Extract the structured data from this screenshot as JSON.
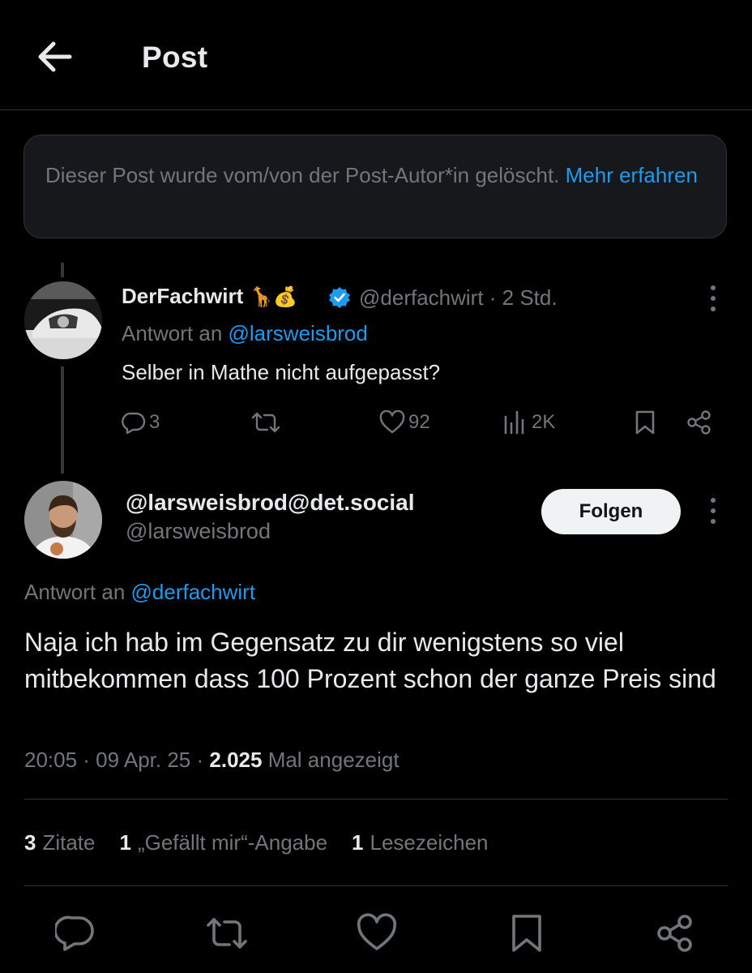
{
  "header": {
    "title": "Post"
  },
  "notice": {
    "text": "Dieser Post wurde vom/von der Post-Autor*in gelöscht. ",
    "link": "Mehr erfahren"
  },
  "reply": {
    "author_name": "DerFachwirt",
    "emojis": "🦒💰",
    "handle_time": "@derfachwirt · 2 Std.",
    "replying_prefix": "Antwort an ",
    "replying_handle": "@larsweisbrod",
    "text": "Selber in Mathe nicht aufgepasst?",
    "replies": "3",
    "likes": "92",
    "views": "2K"
  },
  "main": {
    "author_name": "@larsweisbrod@det.social",
    "handle": "@larsweisbrod",
    "follow_label": "Folgen",
    "replying_prefix": "Antwort an ",
    "replying_handle": "@derfachwirt",
    "body": "Naja ich hab im Gegensatz zu dir wenigstens so viel mitbekommen dass 100 Prozent schon der ganze Preis sind",
    "timestamp": "20:05 · 09 Apr. 25 · ",
    "views_count": "2.025",
    "views_suffix": " Mal angezeigt"
  },
  "stats": {
    "quotes_count": "3",
    "quotes_label": "Zitate",
    "likes_count": "1",
    "likes_label": "„Gefällt mir“-Angabe",
    "bookmarks_count": "1",
    "bookmarks_label": "Lesezeichen"
  },
  "colors": {
    "background": "#000000",
    "accent": "#1d9bf0",
    "muted": "#71767b",
    "verified": "#1d9bf0"
  },
  "icons": [
    "back-arrow-icon",
    "kebab-icon",
    "reply-icon",
    "repost-icon",
    "like-icon",
    "views-icon",
    "bookmark-icon",
    "share-icon",
    "verified-badge-icon"
  ]
}
